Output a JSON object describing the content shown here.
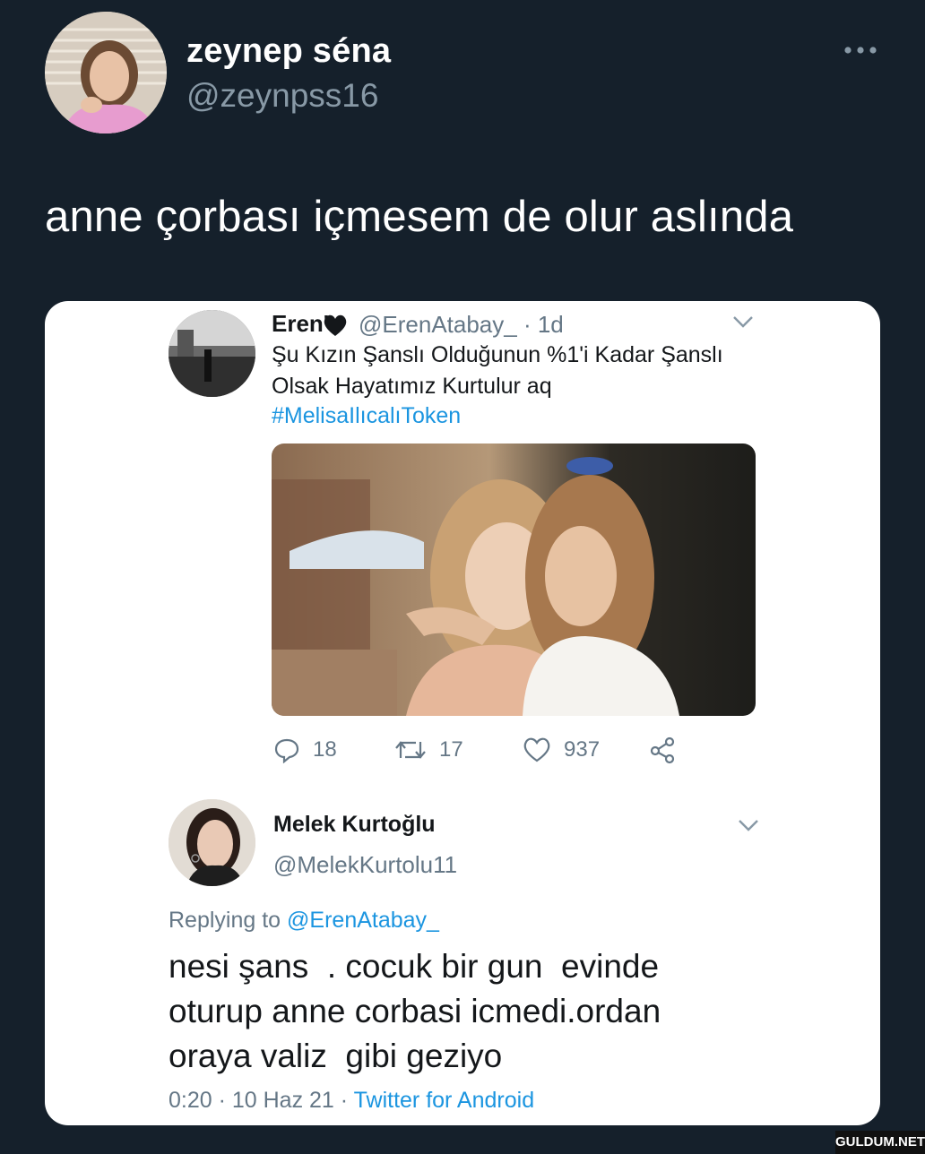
{
  "author": {
    "display_name": "zeynep séna",
    "handle": "@zeynpss16"
  },
  "tweet": {
    "text": "anne çorbası içmesem de olur aslında"
  },
  "quoted_tweet": {
    "name": "Eren'",
    "handle": "@ErenAtabay_",
    "time": "· 1d",
    "lines": [
      "Şu Kızın Şanslı Olduğunun %1'i Kadar Şanslı",
      "Olsak Hayatımız Kurtulur aq"
    ],
    "hashtag": "#MelisaIlıcalıToken",
    "stats": {
      "replies": "18",
      "retweets": "17",
      "likes": "937"
    }
  },
  "reply": {
    "name": "Melek Kurtoğlu",
    "handle": "@MelekKurtolu11",
    "replying_label": "Replying to",
    "replying_to": "@ErenAtabay_",
    "body": "nesi şans  . cocuk bir gun  evinde\noturup anne corbasi icmedi.ordan\noraya valiz  gibi geziyo",
    "time": "0:20 · 10 Haz 21 ·",
    "source": "Twitter for Android"
  },
  "watermark": "GULDUM.NET",
  "colors": {
    "background": "#15202b",
    "muted": "#8899a6",
    "link": "#1b95e0"
  },
  "icons": [
    "more-icon",
    "heart-icon",
    "chevron-down-icon",
    "reply-icon",
    "retweet-icon",
    "like-icon",
    "share-icon"
  ]
}
